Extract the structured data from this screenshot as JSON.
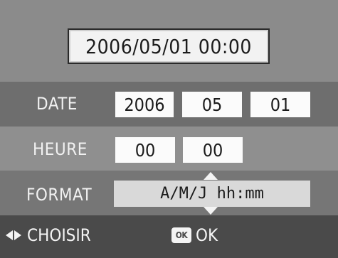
{
  "preview": {
    "datetime": "2006/05/01 00:00"
  },
  "date": {
    "label": "DATE",
    "year": "2006",
    "month": "05",
    "day": "01"
  },
  "heure": {
    "label": "HEURE",
    "hour": "00",
    "minute": "00"
  },
  "format": {
    "label": "FORMAT",
    "value": "A/M/J hh:mm"
  },
  "footer": {
    "choose_label": "CHOISIR",
    "ok_icon_text": "OK",
    "ok_label": "OK"
  },
  "icons": {
    "left_right": "left-right-arrows-icon",
    "ok": "ok-button-icon",
    "up": "up-arrow-icon",
    "down": "down-arrow-icon"
  }
}
